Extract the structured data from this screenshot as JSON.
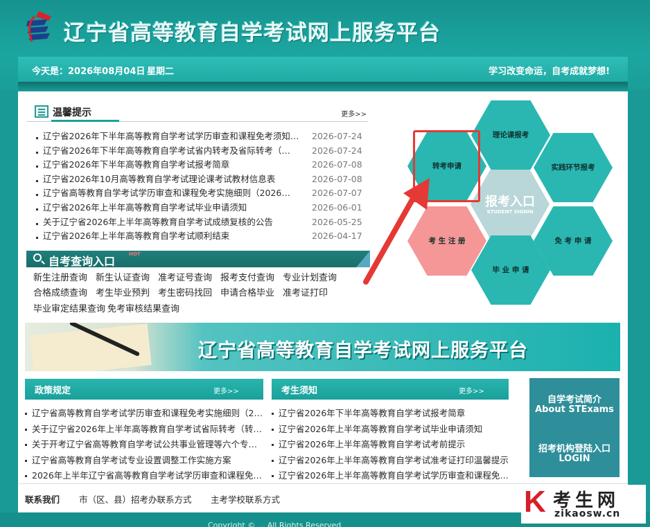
{
  "header": {
    "site_title": "辽宁省高等教育自学考试网上服务平台",
    "date_label": "今天是：2026年08月04日",
    "weekday": "星期二",
    "motto": "学习改变命运，自考成就梦想!"
  },
  "notice": {
    "title": "温馨提示",
    "more": "更多>>",
    "hot_badge": "HOT",
    "items": [
      {
        "text": "辽宁省2026年下半年高等教育自学考试学历审查和课程免考须知",
        "date": "2026-07-24",
        "hot": true
      },
      {
        "text": "辽宁省2026年下半年高等教育自学考试省内转考及省际转考（…",
        "date": "2026-07-24",
        "hot": false
      },
      {
        "text": "辽宁省2026年下半年高等教育自学考试报考简章",
        "date": "2026-07-08",
        "hot": false
      },
      {
        "text": "辽宁省2026年10月高等教育自学考试理论课考试教材信息表",
        "date": "2026-07-08",
        "hot": false
      },
      {
        "text": "辽宁省高等教育自学考试学历审查和课程免考实施细则（2026…",
        "date": "2026-07-07",
        "hot": false
      },
      {
        "text": "辽宁省2026年上半年高等教育自学考试毕业申请须知",
        "date": "2026-06-01",
        "hot": false
      },
      {
        "text": "关于辽宁省2026年上半年高等教育自学考试成绩复核的公告",
        "date": "2026-05-25",
        "hot": false
      },
      {
        "text": "辽宁省2026年上半年高等教育自学考试顺利结束",
        "date": "2026-04-17",
        "hot": false
      }
    ]
  },
  "query": {
    "title": "自考查询入口",
    "hot_badge": "HOT",
    "rows": [
      [
        "新生注册查询",
        "新生认证查询",
        "准考证号查询",
        "报考支付查询",
        "专业计划查询"
      ],
      [
        "合格成绩查询",
        "考生毕业预判",
        "考生密码找回",
        "申请合格毕业",
        "准考证打印"
      ],
      [
        "毕业审定结果查询",
        "免考审核结果查询"
      ]
    ]
  },
  "hex_menu": {
    "theory": "理论课报考",
    "transfer": "转考申请",
    "practice": "实践环节报考",
    "center_title": "报考入口",
    "center_sub": "STUDENT SIGNIN",
    "register": "考 生 注 册",
    "exempt": "免 考 申 请",
    "graduate": "毕 业 申 请"
  },
  "banner": {
    "title": "辽宁省高等教育自学考试网上服务平台"
  },
  "policy": {
    "title": "政策规定",
    "more": "更多>>",
    "items": [
      "辽宁省高等教育自学考试学历审查和课程免考实施细则（2…",
      "关于辽宁省2026年上半年高等教育自学考试省际转考（转…",
      "关于开考辽宁省高等教育自学考试公共事业管理等六个专…",
      "辽宁省高等教育自学考试专业设置调整工作实施方案",
      "2026年上半年辽宁省高等教育自学考试学历审查和课程免…"
    ]
  },
  "guide": {
    "title": "考生须知",
    "more": "更多>>",
    "items": [
      "辽宁省2026年下半年高等教育自学考试报考简章",
      "辽宁省2026年上半年高等教育自学考试毕业申请须知",
      "辽宁省2026年上半年高等教育自学考试考前提示",
      "辽宁省2026年上半年高等教育自学考试准考证打印温馨提示",
      "辽宁省2026年上半年高等教育自学考试学历审查和课程免…"
    ]
  },
  "side": {
    "about_cn": "自学考试简介",
    "about_en": "About STExams",
    "login_cn": "招考机构登陆入口",
    "login_en": "LOGIN"
  },
  "contact": {
    "label": "联系我们",
    "city": "市（区、县）招考办联系方式",
    "school": "主考学校联系方式"
  },
  "footer": {
    "copyright": "Copyright © ... All Rights Reserved"
  },
  "watermark": {
    "k": "K",
    "cn": "考生网",
    "url": "zikaosw.cn"
  }
}
